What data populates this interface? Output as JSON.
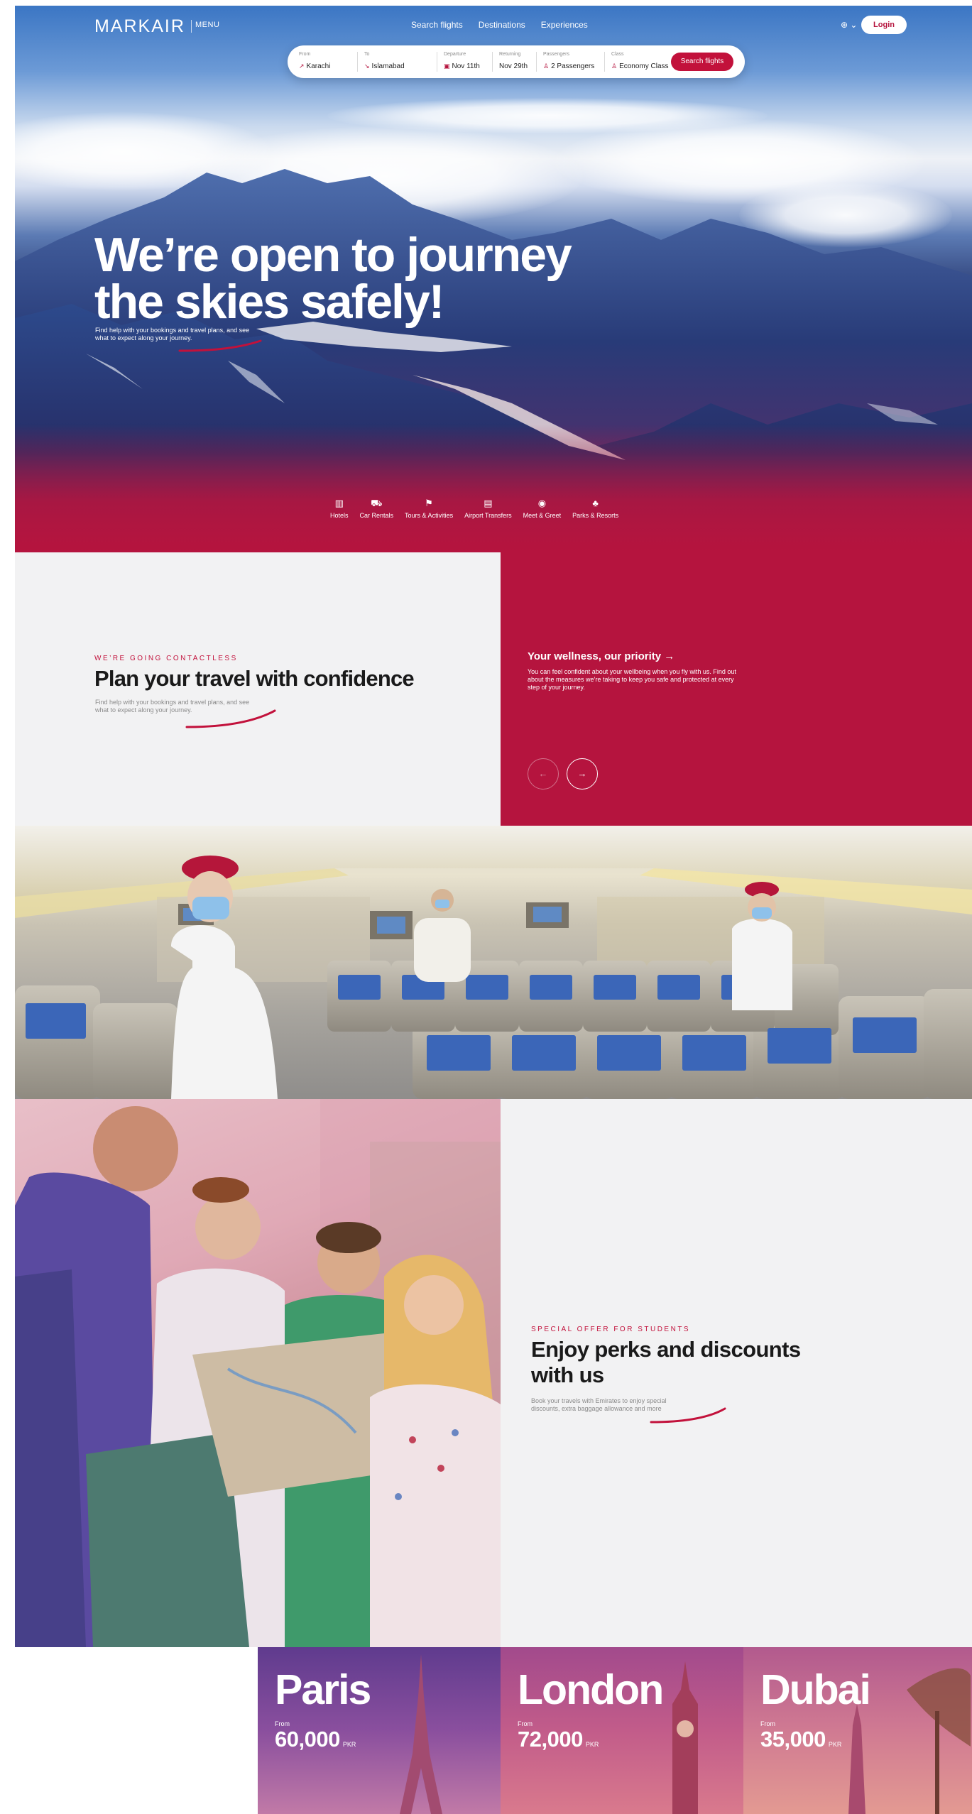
{
  "brand": {
    "logo": "MARKAIR",
    "menu_label": "MENU"
  },
  "nav": {
    "links": [
      "Search flights",
      "Destinations",
      "Experiences"
    ],
    "lang_icon": "globe-icon",
    "lang_caret": "⌄",
    "login_label": "Login"
  },
  "search": {
    "from_label": "From",
    "from_value": "Karachi",
    "to_label": "To",
    "to_value": "Islamabad",
    "departure_label": "Departure",
    "departure_value": "Nov 11th",
    "returning_label": "Returning",
    "returning_value": "Nov 29th",
    "passengers_label": "Passengers",
    "passengers_value": "2 Passengers",
    "class_label": "Class",
    "class_value": "Economy Class",
    "button_label": "Search flights"
  },
  "hero": {
    "title_line1": "We’re open to journey",
    "title_line2": "the skies safely!",
    "subtitle": "Find help with your bookings and travel plans, and see what to expect along your journey."
  },
  "services": [
    {
      "label": "Hotels",
      "icon": "hotel-icon"
    },
    {
      "label": "Car Rentals",
      "icon": "car-icon"
    },
    {
      "label": "Tours & Activities",
      "icon": "tours-icon"
    },
    {
      "label": "Airport Transfers",
      "icon": "bus-icon"
    },
    {
      "label": "Meet & Greet",
      "icon": "greet-icon"
    },
    {
      "label": "Parks & Resorts",
      "icon": "resort-icon"
    }
  ],
  "contactless": {
    "eyebrow": "WE’RE GOING CONTACTLESS",
    "title": "Plan your travel with confidence",
    "subtitle": "Find help with your bookings and travel plans, and see what to expect along your journey.",
    "card_title": "Your wellness, our priority →",
    "card_text": "You can feel confident about your wellbeing when you fly with us. Find out about the measures we’re taking to keep you safe and protected at every step of your journey.",
    "prev_glyph": "←",
    "next_glyph": "→"
  },
  "students": {
    "eyebrow": "SPECIAL OFFER FOR STUDENTS",
    "title": "Enjoy perks and discounts with us",
    "subtitle": "Book your travels with Emirates to enjoy special discounts, extra baggage allowance and more"
  },
  "destinations": [
    {
      "name": "Paris",
      "from_label": "From",
      "price": "60,000",
      "currency": "PKR"
    },
    {
      "name": "London",
      "from_label": "From",
      "price": "72,000",
      "currency": "PKR"
    },
    {
      "name": "Dubai",
      "from_label": "From",
      "price": "35,000",
      "currency": "PKR"
    }
  ],
  "colors": {
    "accent": "#b5143e",
    "button": "#c2113b",
    "panel": "#f2f2f3"
  }
}
